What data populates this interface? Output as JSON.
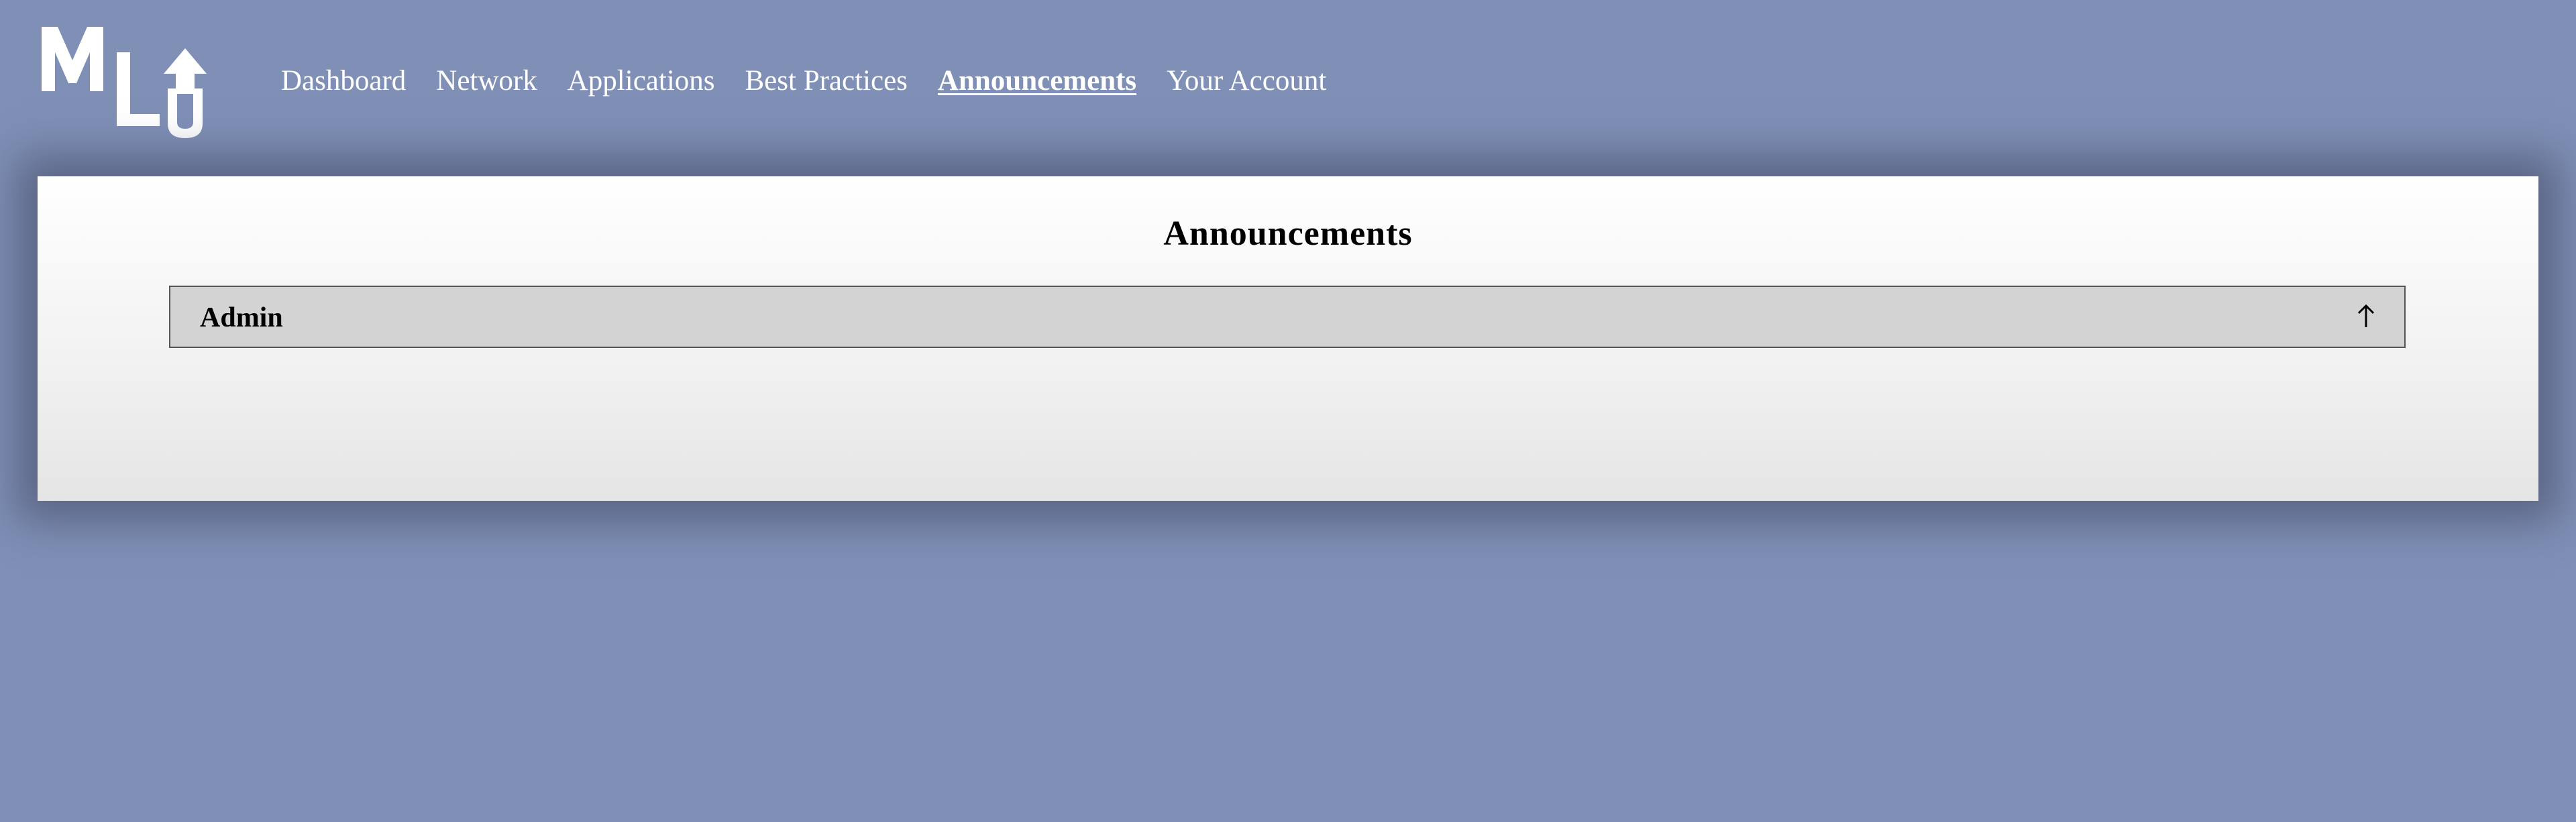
{
  "logo": {
    "alt_text": "MLU"
  },
  "nav": {
    "items": [
      {
        "label": "Dashboard",
        "active": false
      },
      {
        "label": "Network",
        "active": false
      },
      {
        "label": "Applications",
        "active": false
      },
      {
        "label": "Best Practices",
        "active": false
      },
      {
        "label": "Announcements",
        "active": true
      },
      {
        "label": "Your Account",
        "active": false
      }
    ]
  },
  "main": {
    "title": "Announcements",
    "sections": [
      {
        "label": "Admin",
        "icon": "arrow-up-icon",
        "expanded": true
      }
    ]
  },
  "colors": {
    "background": "#7f8fb6",
    "panel": "#ffffff",
    "accordion": "#d3d3d3",
    "nav_text": "#ffffff"
  }
}
